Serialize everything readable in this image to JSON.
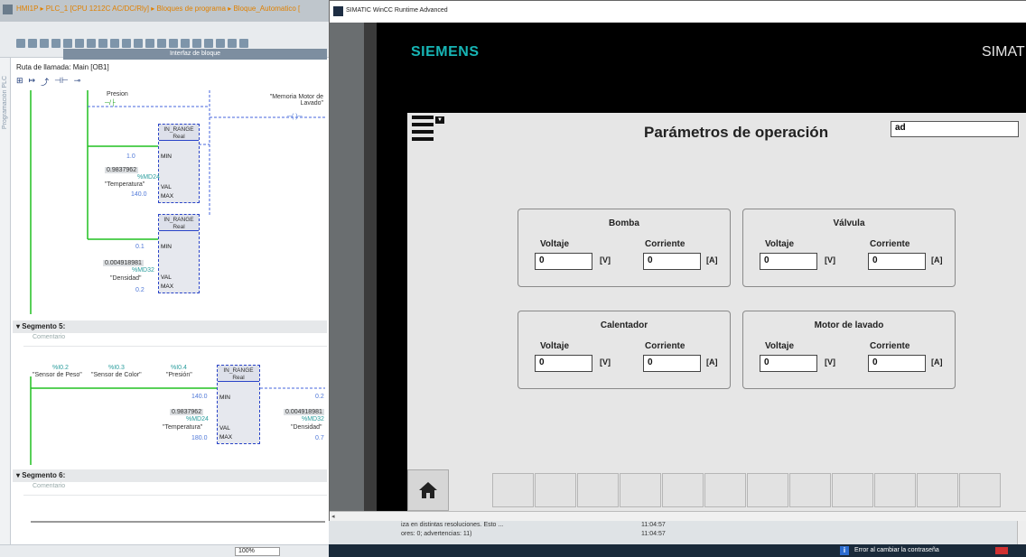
{
  "tia": {
    "title": "HMI1P ▸ PLC_1 [CPU 1212C AC/DC/Rly] ▸ Bloques de programa ▸ Bloque_Automatico [",
    "interface_label": "Interfaz de bloque",
    "call_path": "Ruta de llamada: Main [OB1]",
    "vertical_label": "Programación PLC",
    "segment4": {
      "contact_label": "Presion",
      "coil_label": "\"Memoria Motor de Lavado\"",
      "fb1": {
        "title": "IN_RANGE",
        "type": "Real",
        "min": "1.0",
        "val_value": "0.9837962",
        "val_addr": "%MD24",
        "val_tag": "\"Temperatura\"",
        "max": "140.0"
      },
      "fb2": {
        "title": "IN_RANGE",
        "type": "Real",
        "min": "0.1",
        "val_value": "0.004918981",
        "val_addr": "%MD32",
        "val_tag": "\"Densidad\"",
        "max": "0.2"
      }
    },
    "segment5": {
      "header": "Segmento 5:",
      "comment": "Comentario",
      "c1_addr": "%I0.2",
      "c1_tag": "\"Sensor de Peso\"",
      "c2_addr": "%I0.3",
      "c2_tag": "\"Sensor de Color\"",
      "c3_addr": "%I0.4",
      "c3_tag": "\"Presión\"",
      "fb1": {
        "title": "IN_RANGE",
        "type": "Real",
        "min": "140.0",
        "val_value": "0.9837962",
        "val_addr": "%MD24",
        "val_tag": "\"Temperatura\"",
        "max": "180.0"
      },
      "fb2": {
        "min": "0.2",
        "val_value": "0.004918981",
        "val_addr": "%MD32",
        "val_tag": "\"Densidad\"",
        "max": "0.7"
      }
    },
    "segment6": {
      "header": "Segmento 6:",
      "comment": "Comentario"
    },
    "zoom": "100%"
  },
  "wincc": {
    "window_title": "SIMATIC WinCC Runtime Advanced",
    "brand": "SIEMENS",
    "product": "SIMATIC",
    "screen_title": "Parámetros de operación",
    "search_value": "ad",
    "labels": {
      "voltage": "Voltaje",
      "current": "Corriente",
      "volt_unit": "[V]",
      "amp_unit": "[A]"
    },
    "panels": [
      {
        "name": "Bomba",
        "voltage": "0",
        "current": "0"
      },
      {
        "name": "Válvula",
        "voltage": "0",
        "current": "0"
      },
      {
        "name": "Calentador",
        "voltage": "0",
        "current": "0"
      },
      {
        "name": "Motor de lavado",
        "voltage": "0",
        "current": "0"
      }
    ]
  },
  "info": {
    "line1": "iza en distintas resoluciones. Esto ...",
    "line1_time": "11:04:57",
    "line2": "ores: 0; advertencias: 11)",
    "line2_time": "11:04:57"
  },
  "taskbar": {
    "error_text": "Error al cambiar la contraseña"
  },
  "colors": {
    "siemens_teal": "#17b5b5",
    "fb_border": "#2a44c8",
    "address_teal": "#2a9d9d",
    "hmi_bg": "#e6e6e6"
  }
}
